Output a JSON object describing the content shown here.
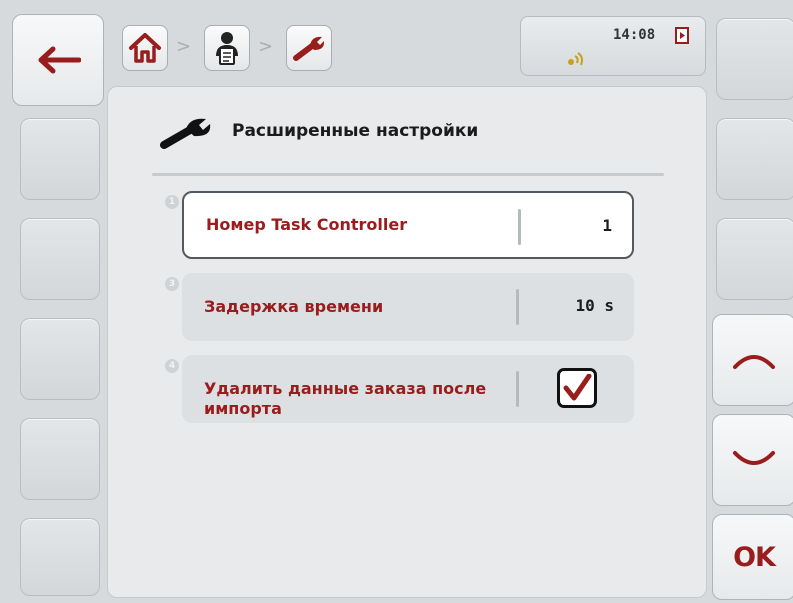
{
  "header": {
    "back_icon": "back-arrow-icon",
    "breadcrumb": [
      {
        "icon": "home-icon"
      },
      {
        "icon": "task-controller-icon"
      },
      {
        "icon": "wrench-icon"
      }
    ],
    "breadcrumb_separator": ">"
  },
  "status": {
    "time": "14:08",
    "indicator_icon": "memory-card-icon",
    "connection_icon": "gps-signal-icon"
  },
  "main": {
    "title": "Расширенные настройки",
    "title_icon": "wrench-icon",
    "items": [
      {
        "index": "1",
        "label": "Номер Task Controller",
        "value": "1",
        "selected": true
      },
      {
        "index": "3",
        "label": "Задержка времени",
        "value": "10 s",
        "selected": false
      },
      {
        "index": "4",
        "label": "Удалить данные заказа после импорта",
        "checked": true,
        "selected": false
      }
    ]
  },
  "softkeys": {
    "up_icon": "chevron-up-icon",
    "down_icon": "chevron-down-icon",
    "ok_label": "OK"
  },
  "colors": {
    "accent": "#9a1d1d",
    "background": "#d6dadc",
    "panel": "#e8eaeb"
  }
}
